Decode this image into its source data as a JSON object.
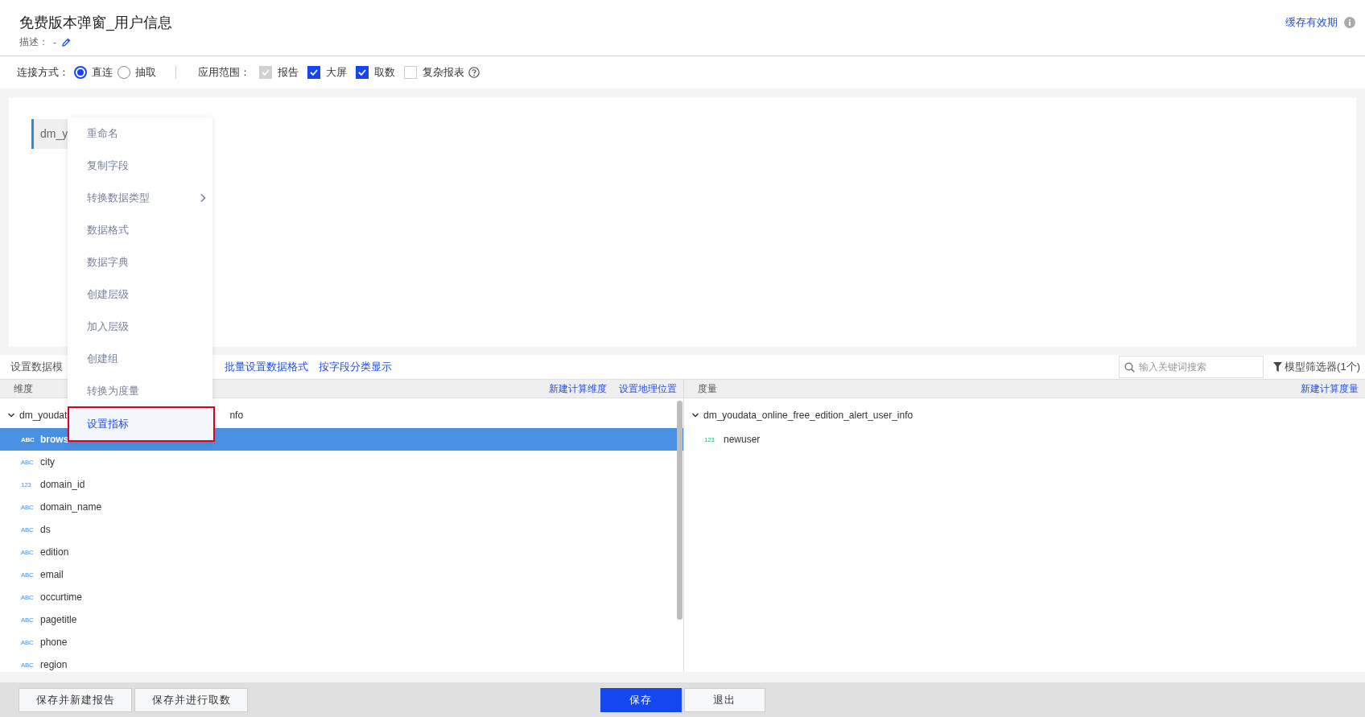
{
  "header": {
    "title": "免费版本弹窗_用户信息",
    "description_label": "描述：",
    "description_value": "-",
    "cache_link": "缓存有效期"
  },
  "options": {
    "connection_label": "连接方式：",
    "connection_modes": [
      {
        "label": "直连",
        "selected": true
      },
      {
        "label": "抽取",
        "selected": false
      }
    ],
    "scope_label": "应用范围：",
    "scopes": [
      {
        "label": "报告",
        "checked": true,
        "disabled": true
      },
      {
        "label": "大屏",
        "checked": true,
        "disabled": false
      },
      {
        "label": "取数",
        "checked": true,
        "disabled": false
      },
      {
        "label": "复杂报表",
        "checked": false,
        "disabled": false
      }
    ]
  },
  "canvas": {
    "nodes": [
      {
        "label": "dm_y"
      }
    ]
  },
  "context_menu": {
    "items": [
      {
        "label": "重命名",
        "has_submenu": false,
        "selected": false
      },
      {
        "label": "复制字段",
        "has_submenu": false,
        "selected": false
      },
      {
        "label": "转换数据类型",
        "has_submenu": true,
        "selected": false
      },
      {
        "label": "数据格式",
        "has_submenu": false,
        "selected": false
      },
      {
        "label": "数据字典",
        "has_submenu": false,
        "selected": false
      },
      {
        "label": "创建层级",
        "has_submenu": false,
        "selected": false
      },
      {
        "label": "加入层级",
        "has_submenu": false,
        "selected": false
      },
      {
        "label": "创建组",
        "has_submenu": false,
        "selected": false
      },
      {
        "label": "转换为度量",
        "has_submenu": false,
        "selected": false
      },
      {
        "label": "设置指标",
        "has_submenu": false,
        "selected": true
      }
    ]
  },
  "fields_toolbar": {
    "label": "设置数据模",
    "links": [
      "批量设置数据格式",
      "按字段分类显示"
    ],
    "search": {
      "placeholder": "输入关键词搜索"
    },
    "filter": "模型筛选器(1个)"
  },
  "dimensions": {
    "title": "维度",
    "actions": [
      "新建计算维度",
      "设置地理位置"
    ],
    "group": {
      "label_start": "dm_youdat",
      "label_end": "nfo",
      "expanded": true,
      "fields": [
        {
          "type": "ABC",
          "name": "brows",
          "selected": true
        },
        {
          "type": "ABC",
          "name": "city",
          "selected": false
        },
        {
          "type": "123",
          "name": "domain_id",
          "selected": false
        },
        {
          "type": "ABC",
          "name": "domain_name",
          "selected": false
        },
        {
          "type": "ABC",
          "name": "ds",
          "selected": false
        },
        {
          "type": "ABC",
          "name": "edition",
          "selected": false
        },
        {
          "type": "ABC",
          "name": "email",
          "selected": false
        },
        {
          "type": "ABC",
          "name": "occurtime",
          "selected": false
        },
        {
          "type": "ABC",
          "name": "pagetitle",
          "selected": false
        },
        {
          "type": "ABC",
          "name": "phone",
          "selected": false
        },
        {
          "type": "ABC",
          "name": "region",
          "selected": false
        }
      ]
    }
  },
  "measures": {
    "title": "度量",
    "actions": [
      "新建计算度量"
    ],
    "group": {
      "label": "dm_youdata_online_free_edition_alert_user_info",
      "expanded": true,
      "fields": [
        {
          "type": "123",
          "name": "newuser",
          "selected": false
        }
      ]
    }
  },
  "footer": {
    "left_buttons": [
      {
        "label": "保存并新建报告",
        "kind": "default"
      },
      {
        "label": "保存并进行取数",
        "kind": "default"
      }
    ],
    "center_buttons": [
      {
        "label": "保存",
        "kind": "primary"
      },
      {
        "label": "退出",
        "kind": "default"
      }
    ]
  }
}
